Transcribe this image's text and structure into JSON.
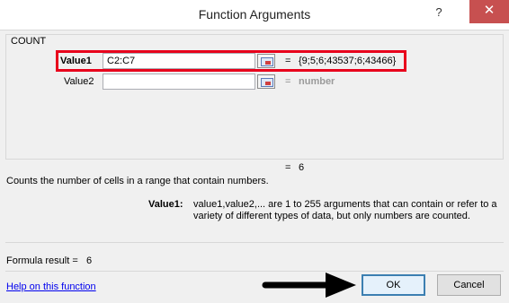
{
  "window": {
    "title": "Function Arguments",
    "help_glyph": "?",
    "close_glyph": "✕"
  },
  "function": {
    "name": "COUNT",
    "args": [
      {
        "label": "Value1",
        "value": "C2:C7",
        "result": "{9;5;6;43537;6;43466}",
        "bold": true
      },
      {
        "label": "Value2",
        "value": "",
        "result": "number",
        "bold": false
      }
    ],
    "result_eq": "6",
    "description": "Counts the number of cells in a range that contain numbers.",
    "arg_help_label": "Value1:",
    "arg_help_text": "value1,value2,... are 1 to 255 arguments that can contain or refer to a variety of different types of data, but only numbers are counted."
  },
  "footer": {
    "formula_result_label": "Formula result =",
    "formula_result_value": "6",
    "help_link": "Help on this function",
    "ok_label": "OK",
    "cancel_label": "Cancel"
  },
  "colors": {
    "highlight_box": "#e8001c",
    "arrow": "#000000",
    "close_button": "#c75050"
  }
}
